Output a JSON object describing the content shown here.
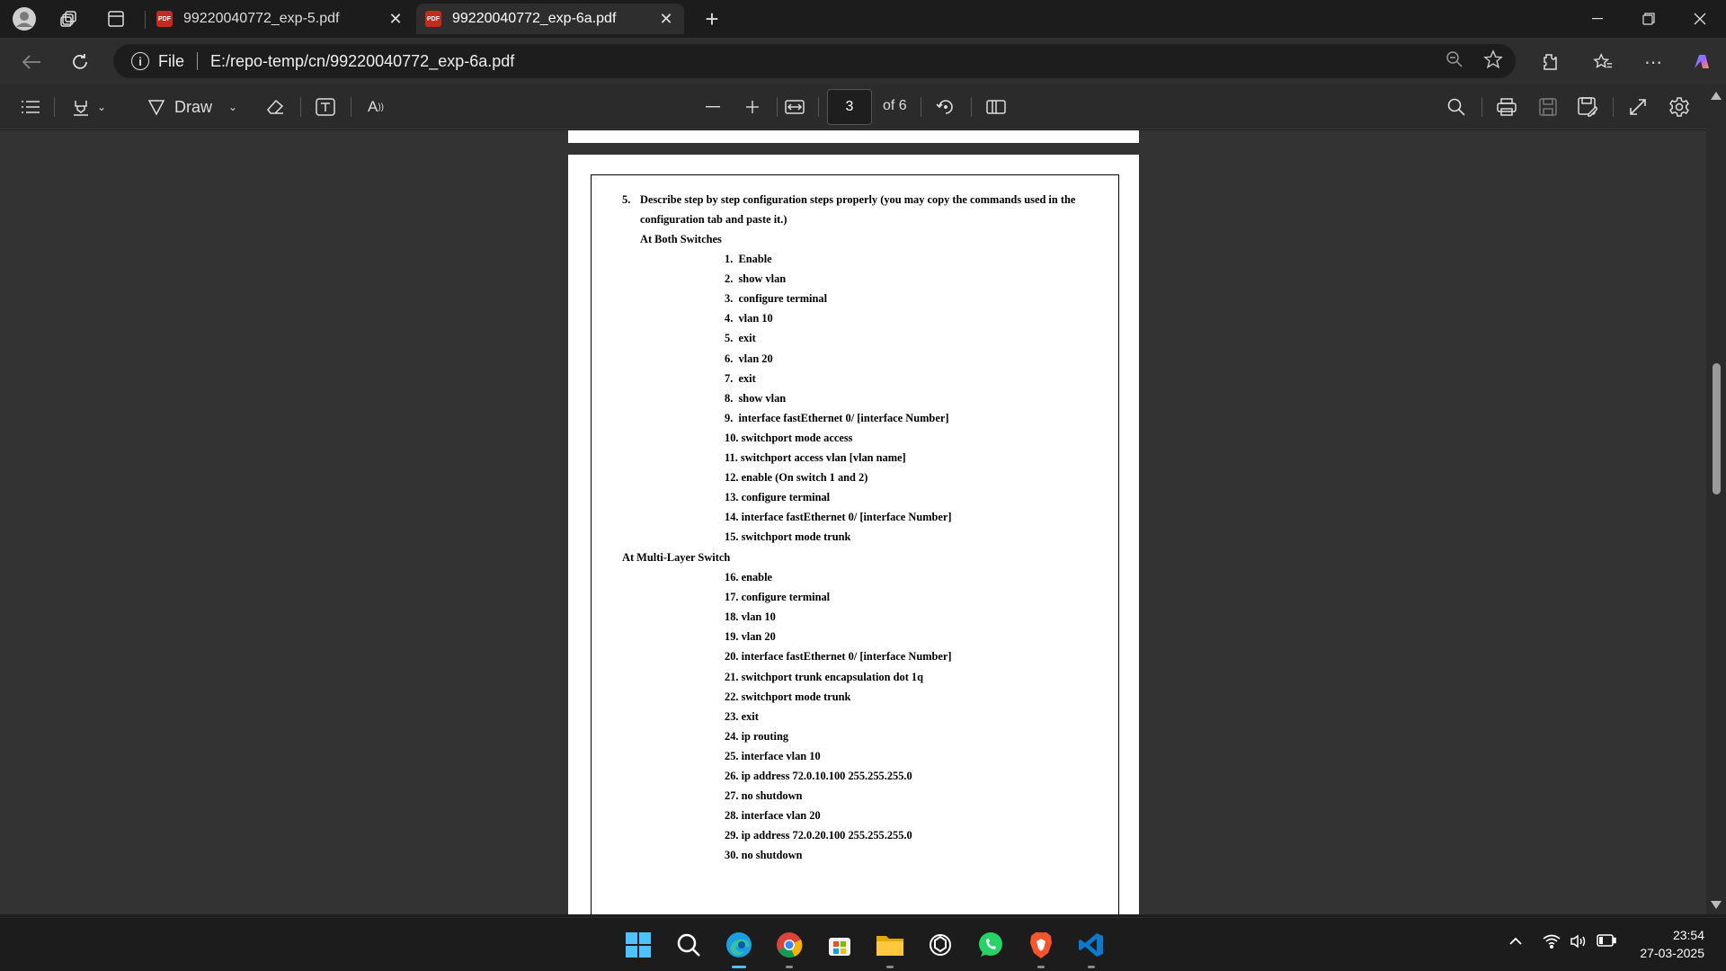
{
  "browser": {
    "tabs": [
      {
        "title": "99220040772_exp-5.pdf",
        "icon": "pdf-icon",
        "active": false
      },
      {
        "title": "99220040772_exp-6a.pdf",
        "icon": "pdf-icon",
        "active": true
      }
    ],
    "address": {
      "scheme_label": "File",
      "url": "E:/repo-temp/cn/99220040772_exp-6a.pdf"
    }
  },
  "pdf_toolbar": {
    "draw_label": "Draw",
    "current_page": "3",
    "page_count": "of 6"
  },
  "document": {
    "question": {
      "number": "5.",
      "line1": "Describe step by step configuration steps properly (you may copy the commands used in the",
      "line2": "configuration tab and paste it.)"
    },
    "section1_title": "At Both Switches",
    "section1_steps": [
      "1.  Enable",
      "2.  show vlan",
      "3.  configure terminal",
      "4.  vlan 10",
      "5.  exit",
      "6.  vlan 20",
      "7.  exit",
      "8.  show vlan",
      "9.  interface fastEthernet 0/ [interface Number]",
      "10. switchport mode access",
      "11. switchport access vlan [vlan name]",
      "12. enable (On switch 1 and 2)",
      "13. configure terminal",
      "14. interface fastEthernet 0/ [interface Number]",
      "15. switchport mode trunk"
    ],
    "section2_title": "At Multi-Layer Switch",
    "section2_steps": [
      "16. enable",
      "17. configure terminal",
      "18. vlan 10",
      "19. vlan 20",
      "20. interface fastEthernet 0/ [interface Number]",
      "21. switchport trunk encapsulation dot 1q",
      "22. switchport mode trunk",
      "23. exit",
      "24. ip routing",
      "25. interface vlan 10",
      "26. ip address 72.0.10.100 255.255.255.0",
      "27. no shutdown",
      "28. interface vlan 20",
      "29. ip address 72.0.20.100 255.255.255.0",
      "30. no shutdown"
    ]
  },
  "taskbar": {
    "apps": [
      "windows-start",
      "search",
      "edge",
      "chrome",
      "microsoft-store",
      "file-explorer",
      "chatgpt",
      "whatsapp",
      "brave",
      "vscode"
    ],
    "time": "23:54",
    "date": "27-03-2025"
  },
  "colors": {
    "accent": "#4cc2ff",
    "pdf_red": "#c42b1c",
    "background": "#333333"
  }
}
